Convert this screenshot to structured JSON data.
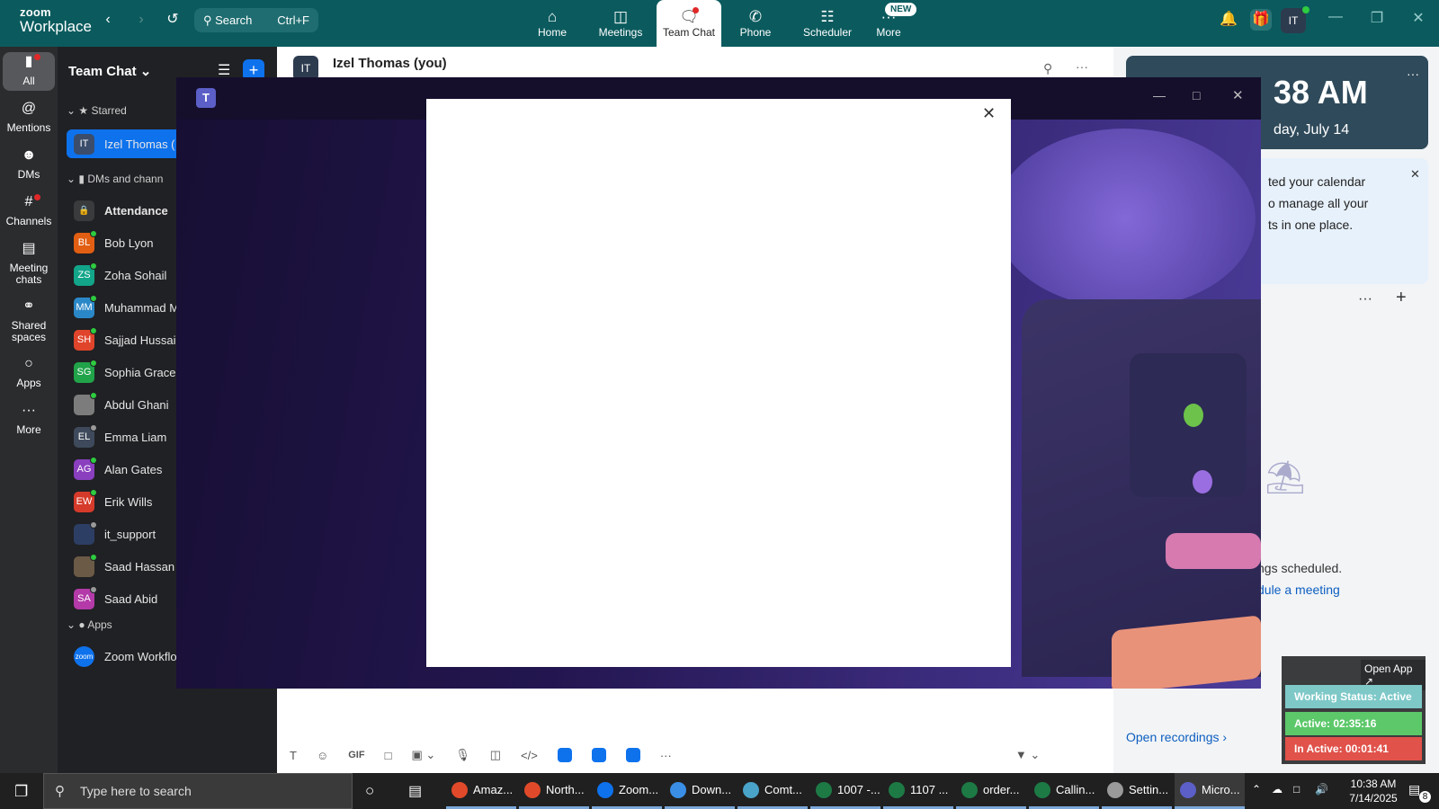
{
  "app": {
    "brand_line1": "zoom",
    "brand_line2": "Workplace"
  },
  "search": {
    "label": "Search",
    "shortcut": "Ctrl+F"
  },
  "nav_tabs": [
    {
      "label": "Home",
      "icon": "home-icon"
    },
    {
      "label": "Meetings",
      "icon": "video-icon"
    },
    {
      "label": "Team Chat",
      "icon": "chat-icon"
    },
    {
      "label": "Phone",
      "icon": "phone-icon"
    },
    {
      "label": "Scheduler",
      "icon": "calendar-icon"
    },
    {
      "label": "More",
      "icon": "more-icon"
    }
  ],
  "new_badge": "NEW",
  "profile_initials": "IT",
  "rail": [
    {
      "label": "All"
    },
    {
      "label": "Mentions"
    },
    {
      "label": "DMs"
    },
    {
      "label": "Channels"
    },
    {
      "label": "Meeting chats"
    },
    {
      "label": "Shared spaces"
    },
    {
      "label": "Apps"
    },
    {
      "label": "More"
    }
  ],
  "chatlist": {
    "title": "Team Chat",
    "section_starred": "Starred",
    "section_dms": "DMs and chann",
    "section_apps": "Apps",
    "starred": [
      {
        "initials": "IT",
        "name": "Izel Thomas (",
        "color": "#3b4d6b"
      }
    ],
    "items": [
      {
        "initials": "",
        "name": "Attendance",
        "color": "#3a3b3d"
      },
      {
        "initials": "BL",
        "name": "Bob Lyon",
        "color": "#e25e12"
      },
      {
        "initials": "ZS",
        "name": "Zoha Sohail",
        "color": "#12a589"
      },
      {
        "initials": "MM",
        "name": "Muhammad M",
        "color": "#2b88c8"
      },
      {
        "initials": "SH",
        "name": "Sajjad Hussai",
        "color": "#e0452b"
      },
      {
        "initials": "SG",
        "name": "Sophia Grace",
        "color": "#21a34a"
      },
      {
        "initials": "",
        "name": "Abdul Ghani",
        "color": "#7c7c7c"
      },
      {
        "initials": "EL",
        "name": "Emma Liam",
        "color": "#3e4a5c"
      },
      {
        "initials": "AG",
        "name": "Alan Gates",
        "color": "#8a3fbf"
      },
      {
        "initials": "EW",
        "name": "Erik Wills",
        "color": "#d63a2a"
      },
      {
        "initials": "",
        "name": "it_support",
        "color": "#2c3e63"
      },
      {
        "initials": "",
        "name": "Saad Hassan",
        "color": "#6b5a45"
      },
      {
        "initials": "SA",
        "name": "Saad Abid",
        "color": "#b33aa8"
      }
    ],
    "apps": [
      {
        "initials": "zoom",
        "name": "Zoom Workflo",
        "color": "#0e72ed"
      }
    ]
  },
  "main_header": {
    "name": "Izel Thomas (you)",
    "avatar": "IT"
  },
  "right_panel": {
    "clock": "38 AM",
    "date": "day, July 14",
    "banner_line1": "ted your calendar",
    "banner_line2": "o manage all your",
    "banner_line3": "ts in one place.",
    "empty_text": "ngs scheduled.",
    "schedule_link": "dule a meeting",
    "open_recordings": "Open recordings"
  },
  "status_widget": {
    "open_app": "Open App ↗",
    "working": "Working Status: Active",
    "active": "Active: 02:35:16",
    "inactive": "In Active: 00:01:41",
    "colors": {
      "working": "#7ec8c8",
      "active": "#5cc86a",
      "inactive": "#e0524a"
    }
  },
  "compose_icons": [
    "text-format-icon",
    "emoji-icon",
    "gif-icon",
    "file-icon",
    "screenshot-icon",
    "mic-icon",
    "video-message-icon",
    "code-icon",
    "app-icon-1",
    "app-icon-2",
    "app-icon-3",
    "more-icon"
  ],
  "compose_gif": "GIF",
  "taskbar": {
    "search_placeholder": "Type here to search",
    "apps": [
      {
        "label": "Amaz...",
        "color": "#e04a2a"
      },
      {
        "label": "North...",
        "color": "#e04a2a"
      },
      {
        "label": "Zoom...",
        "color": "#0e72ed"
      },
      {
        "label": "Down...",
        "color": "#3a8ee6"
      },
      {
        "label": "Comt...",
        "color": "#4aa3c8"
      },
      {
        "label": "1007 -...",
        "color": "#1d7a45"
      },
      {
        "label": "1107 ...",
        "color": "#1d7a45"
      },
      {
        "label": "order...",
        "color": "#1d7a45"
      },
      {
        "label": "Callin...",
        "color": "#1d7a45"
      },
      {
        "label": "Settin...",
        "color": "#9a9a9a"
      },
      {
        "label": "Micro...",
        "color": "#5b5fc7"
      }
    ],
    "time": "10:38 AM",
    "date": "7/14/2025",
    "notif_count": "8"
  }
}
